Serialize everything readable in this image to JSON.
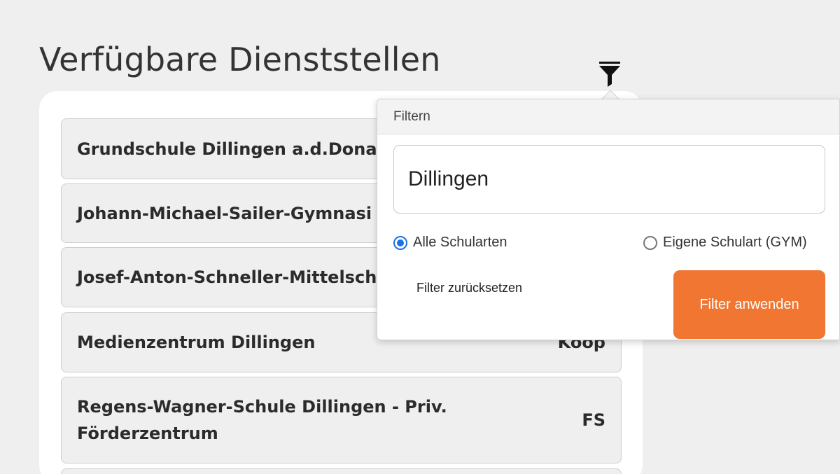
{
  "page": {
    "title": "Verfügbare Dienststellen"
  },
  "filter_toggle": {
    "icon": "filter-funnel-icon"
  },
  "list": {
    "items": [
      {
        "name": "Grundschule Dillingen a.d.Donau",
        "type": ""
      },
      {
        "name": "Johann-Michael-Sailer-Gymnasi",
        "type": ""
      },
      {
        "name": "Josef-Anton-Schneller-Mittelsch",
        "type": ""
      },
      {
        "name": "Medienzentrum Dillingen",
        "type": "Koop"
      },
      {
        "name": "Regens-Wagner-Schule Dillingen - Priv. Förderzentrum",
        "type": "FS"
      }
    ]
  },
  "filter_popover": {
    "header": "Filtern",
    "search_value": "Dillingen",
    "option_all": "Alle Schularten",
    "option_own": "Eigene Schulart (GYM)",
    "selected": "all",
    "reset_label": "Filter zurücksetzen",
    "apply_label": "Filter anwenden"
  },
  "colors": {
    "accent": "#f07631",
    "radio_selected": "#1a73e8",
    "background": "#efefef",
    "card": "#ffffff"
  }
}
